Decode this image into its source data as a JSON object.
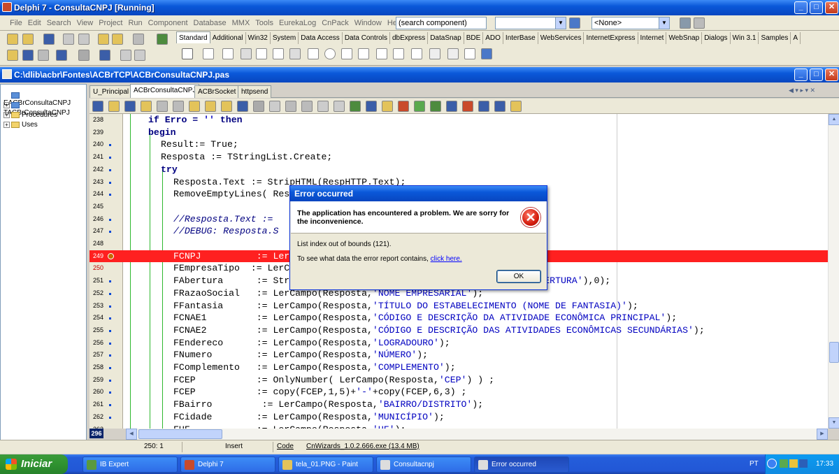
{
  "ide": {
    "title": "Delphi 7 - ConsultaCNPJ [Running]",
    "menu": [
      "File",
      "Edit",
      "Search",
      "View",
      "Project",
      "Run",
      "Component",
      "Database",
      "MMX",
      "Tools",
      "EurekaLog",
      "CnPack",
      "Window",
      "Help"
    ],
    "search_component": "(search component)",
    "combo_none": "<None>",
    "palette_tabs": [
      "Standard",
      "Additional",
      "Win32",
      "System",
      "Data Access",
      "Data Controls",
      "dbExpress",
      "DataSnap",
      "BDE",
      "ADO",
      "InterBase",
      "WebServices",
      "InternetExpress",
      "Internet",
      "WebSnap",
      "Dialogs",
      "Win 3.1",
      "Samples",
      "A"
    ]
  },
  "editor": {
    "title": "C:\\dlib\\acbr\\Fontes\\ACBrTCP\\ACBrConsultaCNPJ.pas",
    "tree": [
      "EACBrConsultaCNPJ",
      "TACBrConsultaCNPJ",
      "Procedures",
      "Uses"
    ],
    "tabs": [
      "U_Principal",
      "ACBrConsultaCNPJ",
      "ACBrSocket",
      "httpsend"
    ],
    "active_tab": "ACBrConsultaCNPJ",
    "lines": [
      {
        "n": "238",
        "text": "if Erro = '' then"
      },
      {
        "n": "239",
        "text": "begin"
      },
      {
        "n": "240",
        "text": "Result:= True;"
      },
      {
        "n": "241",
        "text": "Resposta := TStringList.Create;"
      },
      {
        "n": "242",
        "text": "try"
      },
      {
        "n": "243",
        "text": "Resposta.Text := StripHTML(RespHTTP.Text);"
      },
      {
        "n": "244",
        "text": "RemoveEmptyLines( Resposta );"
      },
      {
        "n": "245",
        "text": ""
      },
      {
        "n": "246",
        "text": "//Resposta.Text := "
      },
      {
        "n": "247",
        "text": "//DEBUG: Resposta.S"
      },
      {
        "n": "248",
        "text": ""
      },
      {
        "n": "249",
        "text": "FCNPJ          := LerCampo(Resposta,'NÚMERO DE INSCRIÇÃO');"
      },
      {
        "n": "250",
        "text": "FEmpresaTipo  := LerCampo(Resposta,'MATRIZ');"
      },
      {
        "n": "251",
        "text": "FAbertura      := StringToDateTimeDef(LerCampo(Resposta,'DATA DE ABERTURA'),0);"
      },
      {
        "n": "252",
        "text": "FRazaoSocial   := LerCampo(Resposta,'NOME EMPRESARIAL');"
      },
      {
        "n": "253",
        "text": "FFantasia      := LerCampo(Resposta,'TÍTULO DO ESTABELECIMENTO (NOME DE FANTASIA)');"
      },
      {
        "n": "254",
        "text": "FCNAE1         := LerCampo(Resposta,'CÓDIGO E DESCRIÇÃO DA ATIVIDADE ECONÔMICA PRINCIPAL');"
      },
      {
        "n": "255",
        "text": "FCNAE2         := LerCampo(Resposta,'CÓDIGO E DESCRIÇÃO DAS ATIVIDADES ECONÔMICAS SECUNDÁRIAS');"
      },
      {
        "n": "256",
        "text": "FEndereco      := LerCampo(Resposta,'LOGRADOURO');"
      },
      {
        "n": "257",
        "text": "FNumero        := LerCampo(Resposta,'NÚMERO');"
      },
      {
        "n": "258",
        "text": "FComplemento   := LerCampo(Resposta,'COMPLEMENTO');"
      },
      {
        "n": "259",
        "text": "FCEP           := OnlyNumber( LerCampo(Resposta,'CEP') ) ;"
      },
      {
        "n": "260",
        "text": "FCEP           := copy(FCEP,1,5)+'-'+copy(FCEP,6,3) ;"
      },
      {
        "n": "261",
        "text": "FBairro         := LerCampo(Resposta,'BAIRRO/DISTRITO');"
      },
      {
        "n": "262",
        "text": "FCidade        := LerCampo(Resposta,'MUNICÍPIO');"
      },
      {
        "n": "263",
        "text": "FUF            := LerCampo(Resposta,'UF');"
      }
    ],
    "current_line_badge": "296",
    "status": {
      "position": "250:  1",
      "mode": "Insert",
      "code_tab": "Code",
      "cnwizards": "CnWizards_1.0.2.666.exe (13.4 MB)"
    }
  },
  "dialog": {
    "title": "Error occurred",
    "headline": "The application has encountered a problem. We are sorry for the inconvenience.",
    "error": "List index out of bounds (121).",
    "report_prefix": "To see what data the error report contains, ",
    "report_link": "click here.",
    "ok": "OK"
  },
  "taskbar": {
    "start": "Iniciar",
    "items": [
      "IB Expert",
      "Delphi 7",
      "tela_01.PNG - Paint",
      "Consultacnpj",
      "Error occurred"
    ],
    "lang": "PT",
    "clock": "17:33"
  }
}
